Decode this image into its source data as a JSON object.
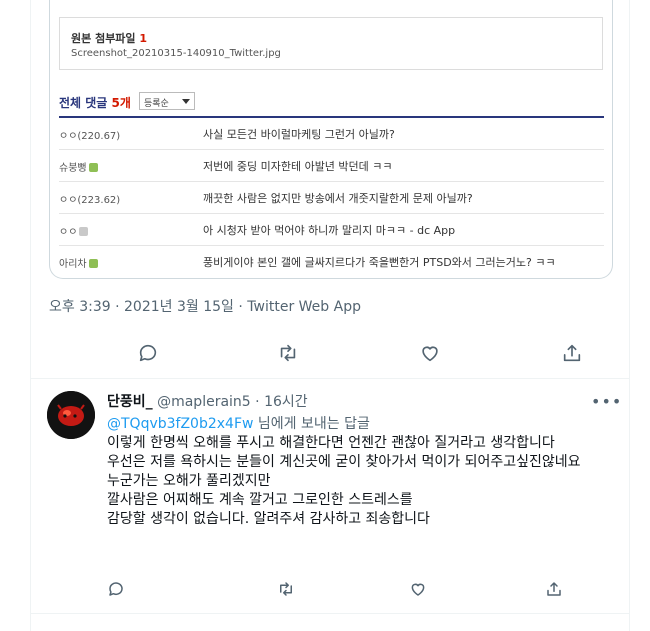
{
  "embedded": {
    "attachment_title": "원본 첨부파일",
    "attachment_count": "1",
    "attachment_file": "Screenshot_20210315-140910_Twitter.jpg",
    "comments_title": "전체 댓글",
    "comments_count": "5개",
    "sort_label": "등록순",
    "comments": [
      {
        "nick": "ㅇㅇ(220.67)",
        "text": "사실 모든건 바이럴마케팅 그런거 아닐까?"
      },
      {
        "nick": "슈붕뻥",
        "text": "저번에 중딩 미자한테 아발년 박던데 ㅋㅋ"
      },
      {
        "nick": "ㅇㅇ(223.62)",
        "text": "깨끗한 사람은 없지만 방송에서 개줏지랄한게 문제 아닐까?"
      },
      {
        "nick": "ㅇㅇ",
        "text": "아 시청자 받아 먹어야 하니까 말리지 마ㅋㅋ - dc App"
      },
      {
        "nick": "아리차",
        "text": "풍비게이야 본인 갤에 글싸지르다가 죽을뻔한거 PTSD와서 그러는거노? ㅋㅋ"
      }
    ]
  },
  "tweet": {
    "time": "오후 3:39",
    "date": "2021년 3월 15일",
    "source": "Twitter Web App",
    "sep": "·"
  },
  "reply": {
    "name": "단풍비_",
    "handle": "@maplerain5",
    "time": "16시간",
    "sep": "·",
    "mention": "@TQqvb3fZ0b2x4Fw",
    "replying_suffix": "님에게 보내는 답글",
    "more": "•••",
    "lines": [
      "이렇게 한명씩 오해를 푸시고 해결한다면 언젠간 괜찮아 질거라고 생각합니다",
      "우선은 저를 욕하시는 분들이 계신곳에 굳이 찾아가서 먹이가 되어주고싶진않네요",
      "누군가는 오해가 풀리겠지만",
      "깔사람은 어찌해도 계속 깔거고 그로인한 스트레스를",
      "감당할 생각이 없습니다. 알려주셔 감사하고 죄송합니다"
    ]
  },
  "colors": {
    "accent": "#1d9bf0",
    "muted": "#536471",
    "dc_blue": "#29367c",
    "dc_red": "#d31900"
  }
}
